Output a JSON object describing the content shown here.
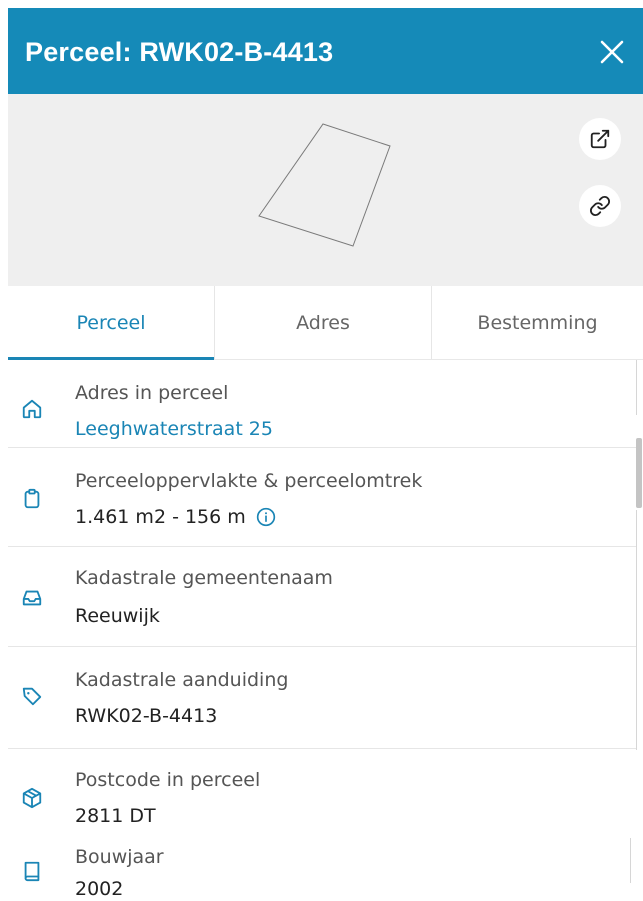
{
  "header": {
    "title": "Perceel: RWK02-B-4413",
    "background_color": "#158ab8"
  },
  "map_controls": [
    {
      "icon": "external-link-icon"
    },
    {
      "icon": "link-icon"
    }
  ],
  "tabs": [
    {
      "label": "Perceel",
      "active": true
    },
    {
      "label": "Adres",
      "active": false
    },
    {
      "label": "Bestemming",
      "active": false
    }
  ],
  "details": [
    {
      "icon": "home-icon",
      "label": "Adres in perceel",
      "value": "Leeghwaterstraat 25",
      "value_is_link": true
    },
    {
      "icon": "clipboard-icon",
      "label": "Perceeloppervlakte & perceelomtrek",
      "value": "1.461 m2 - 156 m",
      "has_info": true
    },
    {
      "icon": "inbox-icon",
      "label": "Kadastrale gemeentenaam",
      "value": "Reeuwijk"
    },
    {
      "icon": "tag-icon",
      "label": "Kadastrale aanduiding",
      "value": "RWK02-B-4413"
    },
    {
      "icon": "package-icon",
      "label": "Postcode in perceel",
      "value": "2811 DT"
    },
    {
      "icon": "book-icon",
      "label": "Bouwjaar",
      "value": "2002"
    }
  ],
  "accent_color": "#1a85b5"
}
